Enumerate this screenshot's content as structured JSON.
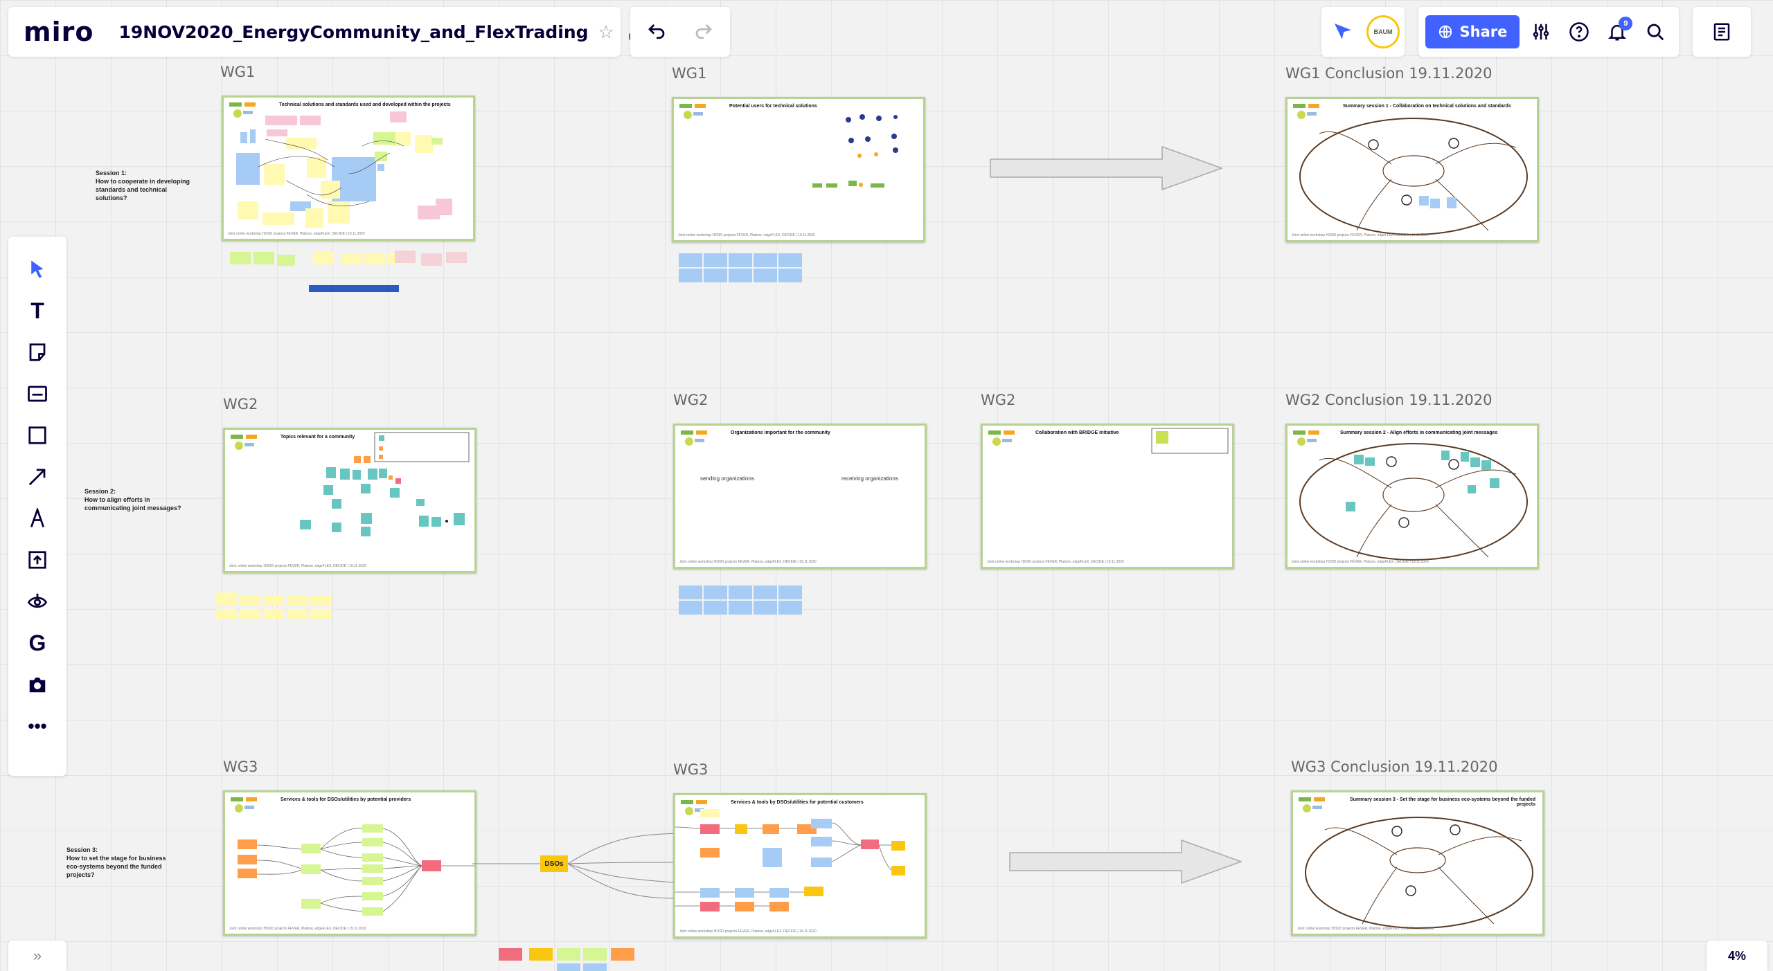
{
  "app": {
    "logo": "miro",
    "board_title": "19NOV2020_EnergyCommunity_and_FlexTrading"
  },
  "topbar": {
    "share_label": "Share",
    "notification_count": "9",
    "avatar_text": "BAUM",
    "zoom_level": "4%"
  },
  "colors": {
    "accent": "#4262ff",
    "frame_border": "#b7d38f",
    "yellow": "#fff9b1",
    "blue": "#a6ccf5",
    "green": "#d5f692",
    "pink": "#f5d1d8",
    "teal": "#67c6c0",
    "orange": "#ff9d48",
    "red": "#f16c7f",
    "gold": "#fac710"
  },
  "toolbar": {
    "tools": [
      {
        "name": "select",
        "icon": "cursor-icon"
      },
      {
        "name": "text",
        "icon": "text-icon"
      },
      {
        "name": "sticky",
        "icon": "sticky-note-icon"
      },
      {
        "name": "card",
        "icon": "card-icon"
      },
      {
        "name": "shape",
        "icon": "square-icon"
      },
      {
        "name": "arrow",
        "icon": "arrow-icon"
      },
      {
        "name": "pen",
        "icon": "pen-icon"
      },
      {
        "name": "upload",
        "icon": "upload-icon"
      },
      {
        "name": "comments",
        "icon": "eye-icon"
      },
      {
        "name": "google",
        "icon": "google-icon"
      },
      {
        "name": "camera",
        "icon": "camera-icon"
      },
      {
        "name": "more",
        "icon": "more-icon"
      }
    ]
  },
  "labels": {
    "wg1_a": "WG1",
    "wg1_b": "WG1",
    "wg1_c": "WG1 Conclusion 19.11.2020",
    "wg2_a": "WG2",
    "wg2_b": "WG2",
    "wg2_c": "WG2",
    "wg2_d": "WG2 Conclusion 19.11.2020",
    "wg3_a": "WG3",
    "wg3_b": "WG3",
    "wg3_c": "WG3 Conclusion 19.11.2020"
  },
  "sessions": {
    "s1": "Session 1:\nHow to cooperate in developing\nstandards and technical\nsolutions?",
    "s2": "Session 2:\nHow to align efforts in\ncommunicating joint messages?",
    "s3": "Session 3:\nHow to set the stage for business\neco-systems beyond the funded\nprojects?"
  },
  "frames": {
    "f1": "Technical solutions and standards used and developed within the projects",
    "f2": "Potential users for technical solutions",
    "f3": "Summary session 1 - Collaboration on technical solutions and standards",
    "f4": "Topics relevant for a community",
    "f5": "Organizations important for the community",
    "f6": "Collaboration with BRIDGE initiative",
    "f7": "Summary session 2 - Align efforts in communicating joint messages",
    "f8": "Services & tools for DSOs/utilities by potential providers",
    "f9": "Services & tools by DSOs/utilities for potential customers",
    "f10": "Summary session 3 - Set the stage for business eco-systems beyond the funded projects",
    "sending": "sending organizations",
    "receiving": "receiving organizations",
    "dsos": "DSOs",
    "footer": "Joint online workshop H2020 projects FEVER, Platone, edgeFLEX, DECIDE | 19.11.2020"
  }
}
